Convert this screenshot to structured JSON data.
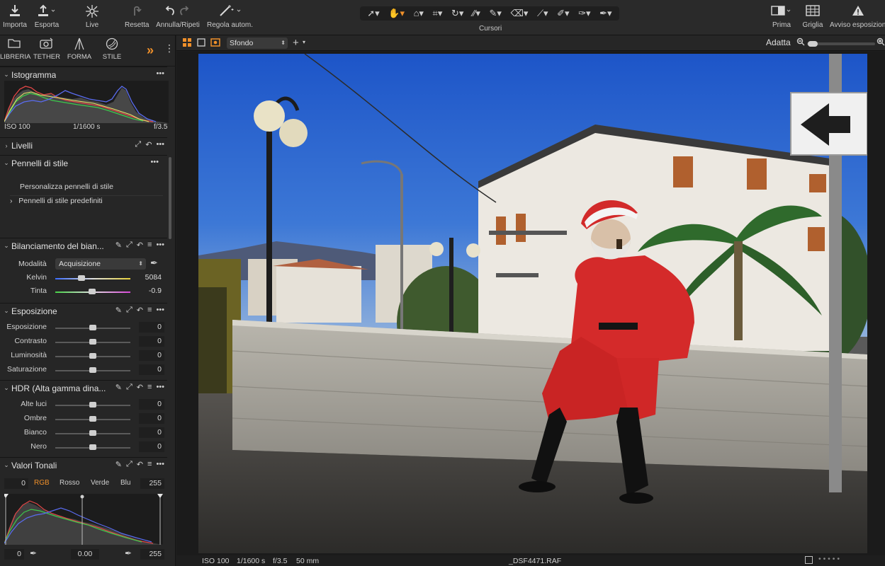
{
  "toolbar": {
    "import": "Importa",
    "export": "Esporta",
    "live": "Live",
    "reset": "Resetta",
    "undo_redo": "Annulla/Ripeti",
    "auto_adjust": "Regola autom.",
    "cursors": "Cursori",
    "before": "Prima",
    "grid": "Griglia",
    "exposure_warning": "Avviso esposizione"
  },
  "tool_tabs": {
    "library": "LIBRERIA",
    "tether": "TETHER",
    "shape": "FORMA",
    "style": "STILE"
  },
  "histogram": {
    "title": "Istogramma",
    "iso": "ISO 100",
    "shutter": "1/1600 s",
    "aperture": "f/3.5"
  },
  "layers": {
    "title": "Livelli"
  },
  "style_brushes": {
    "title": "Pennelli di stile",
    "customize": "Personalizza pennelli di stile",
    "predefined": "Pennelli di stile predefiniti"
  },
  "white_balance": {
    "title": "Bilanciamento del bian...",
    "mode_label": "Modalità",
    "mode_value": "Acquisizione",
    "kelvin_label": "Kelvin",
    "kelvin_value": "5084",
    "tint_label": "Tinta",
    "tint_value": "-0.9"
  },
  "exposure": {
    "title": "Esposizione",
    "rows": [
      {
        "label": "Esposizione",
        "value": "0"
      },
      {
        "label": "Contrasto",
        "value": "0"
      },
      {
        "label": "Luminosità",
        "value": "0"
      },
      {
        "label": "Saturazione",
        "value": "0"
      }
    ]
  },
  "hdr": {
    "title": "HDR (Alta gamma dina...",
    "rows": [
      {
        "label": "Alte luci",
        "value": "0"
      },
      {
        "label": "Ombre",
        "value": "0"
      },
      {
        "label": "Bianco",
        "value": "0"
      },
      {
        "label": "Nero",
        "value": "0"
      }
    ]
  },
  "levels": {
    "title": "Valori Tonali",
    "input_low": "0",
    "input_high": "255",
    "channels": [
      "RGB",
      "Rosso",
      "Verde",
      "Blu"
    ],
    "output_low": "0",
    "midpoint": "0.00",
    "output_high": "255"
  },
  "viewer": {
    "background": "Sfondo",
    "fit": "Adatta"
  },
  "status": {
    "iso": "ISO 100",
    "shutter": "1/1600 s",
    "aperture": "f/3.5",
    "focal": "50 mm",
    "filename": "_DSF4471.RAF"
  },
  "colors": {
    "accent": "#f0902a",
    "panel": "#262626",
    "toolbar": "#2a2a2a"
  }
}
